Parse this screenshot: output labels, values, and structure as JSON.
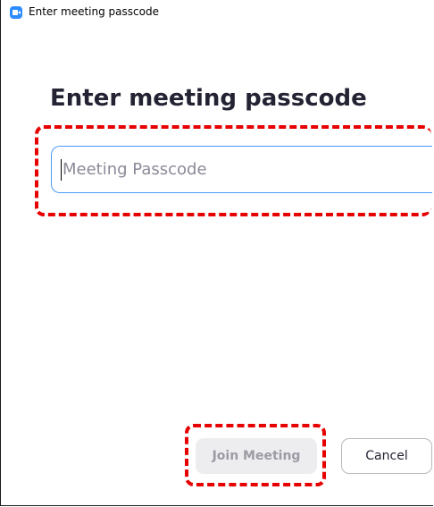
{
  "window": {
    "title": "Enter meeting passcode"
  },
  "dialog": {
    "heading": "Enter meeting passcode",
    "passcode_input": {
      "value": "",
      "placeholder": "Meeting Passcode"
    },
    "join_button_label": "Join Meeting",
    "cancel_button_label": "Cancel"
  },
  "icons": {
    "app_icon": "zoom-camera-icon"
  },
  "colors": {
    "accent": "#2d8cff",
    "input_focus_border": "#4a9af5",
    "highlight": "#e60000",
    "join_disabled_bg": "#ededf0",
    "join_disabled_text": "#9b9ba5",
    "heading_text": "#232333"
  },
  "state": {
    "join_button_enabled": false
  }
}
